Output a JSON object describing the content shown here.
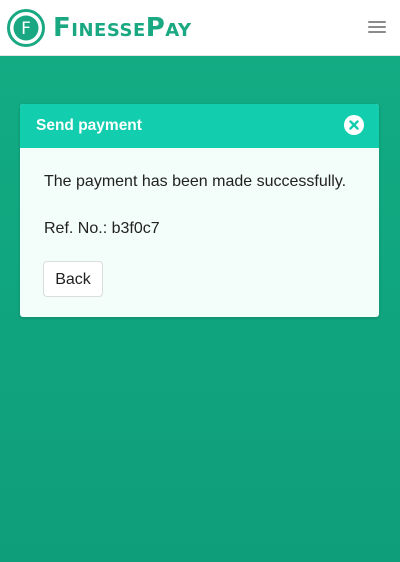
{
  "brand": {
    "name": "FinessePay",
    "logo_letter": "F",
    "color": "#1aa882"
  },
  "header": {
    "menu_icon": "hamburger-menu-icon"
  },
  "background": {
    "color": "#12ad84"
  },
  "dialog": {
    "title": "Send payment",
    "header_color": "#12cdae",
    "close_icon": "close-icon",
    "message": "The payment has been made successfully.",
    "ref_text": "Ref. No.: b3f0c7",
    "back_label": "Back"
  }
}
